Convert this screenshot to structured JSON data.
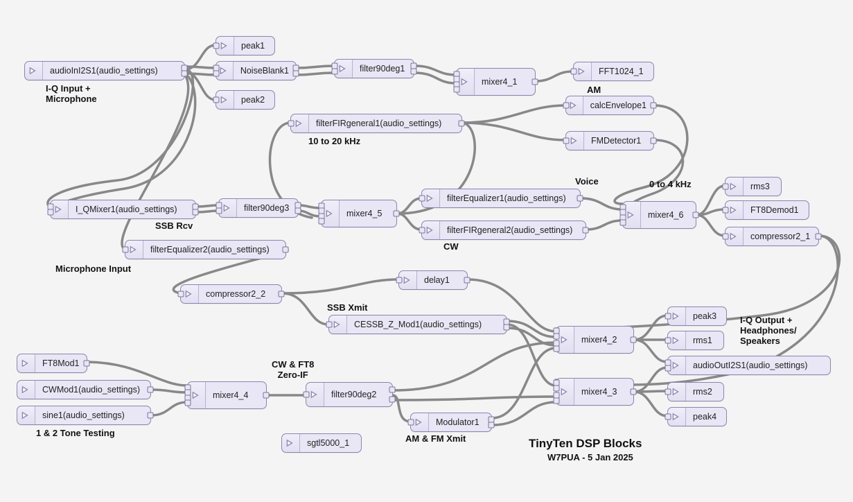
{
  "title": "TinyTen DSP Blocks",
  "subtitle": "W7PUA - 5 Jan 2025",
  "annotations": {
    "iq_in": "I-Q Input +\nMicrophone",
    "ssb_rcv": "SSB Rcv",
    "mic_in": "Microphone Input",
    "ten20": "10 to 20 kHz",
    "am": "AM",
    "voice": "Voice",
    "cw": "CW",
    "zero4": "0 to 4 kHz",
    "ssb_xmit": "SSB Xmit",
    "cw_ft8": "CW & FT8\nZero-IF",
    "amfm_xmit": "AM & FM Xmit",
    "tone12": "1 & 2 Tone Testing",
    "iq_out": "I-Q Output +\nHeadphones/\nSpeakers"
  },
  "nodes": {
    "audioIn": "audioInI2S1(audio_settings)",
    "peak1": "peak1",
    "peak2": "peak2",
    "noiseblank": "NoiseBlank1",
    "filter90deg1": "filter90deg1",
    "mixer4_1": "mixer4_1",
    "fft": "FFT1024_1",
    "filterFIR1": "filterFIRgeneral1(audio_settings)",
    "calcEnv": "calcEnvelope1",
    "fmdet": "FMDetector1",
    "iqmixer": "I_QMixer1(audio_settings)",
    "filter90deg3": "filter90deg3",
    "mixer4_5": "mixer4_5",
    "filterEq1": "filterEqualizer1(audio_settings)",
    "filterFIR2": "filterFIRgeneral2(audio_settings)",
    "mixer4_6": "mixer4_6",
    "rms3": "rms3",
    "ft8demod": "FT8Demod1",
    "compressor21": "compressor2_1",
    "filterEq2": "filterEqualizer2(audio_settings)",
    "compressor22": "compressor2_2",
    "delay1": "delay1",
    "cessb": "CESSB_Z_Mod1(audio_settings)",
    "mixer4_2": "mixer4_2",
    "mixer4_3": "mixer4_3",
    "peak3": "peak3",
    "rms1": "rms1",
    "audioOut": "audioOutI2S1(audio_settings)",
    "rms2": "rms2",
    "peak4": "peak4",
    "ft8mod": "FT8Mod1",
    "cwmod": "CWMod1(audio_settings)",
    "sine1": "sine1(audio_settings)",
    "mixer4_4": "mixer4_4",
    "filter90deg2": "filter90deg2",
    "modulator1": "Modulator1",
    "sgtl": "sgtl5000_1"
  }
}
